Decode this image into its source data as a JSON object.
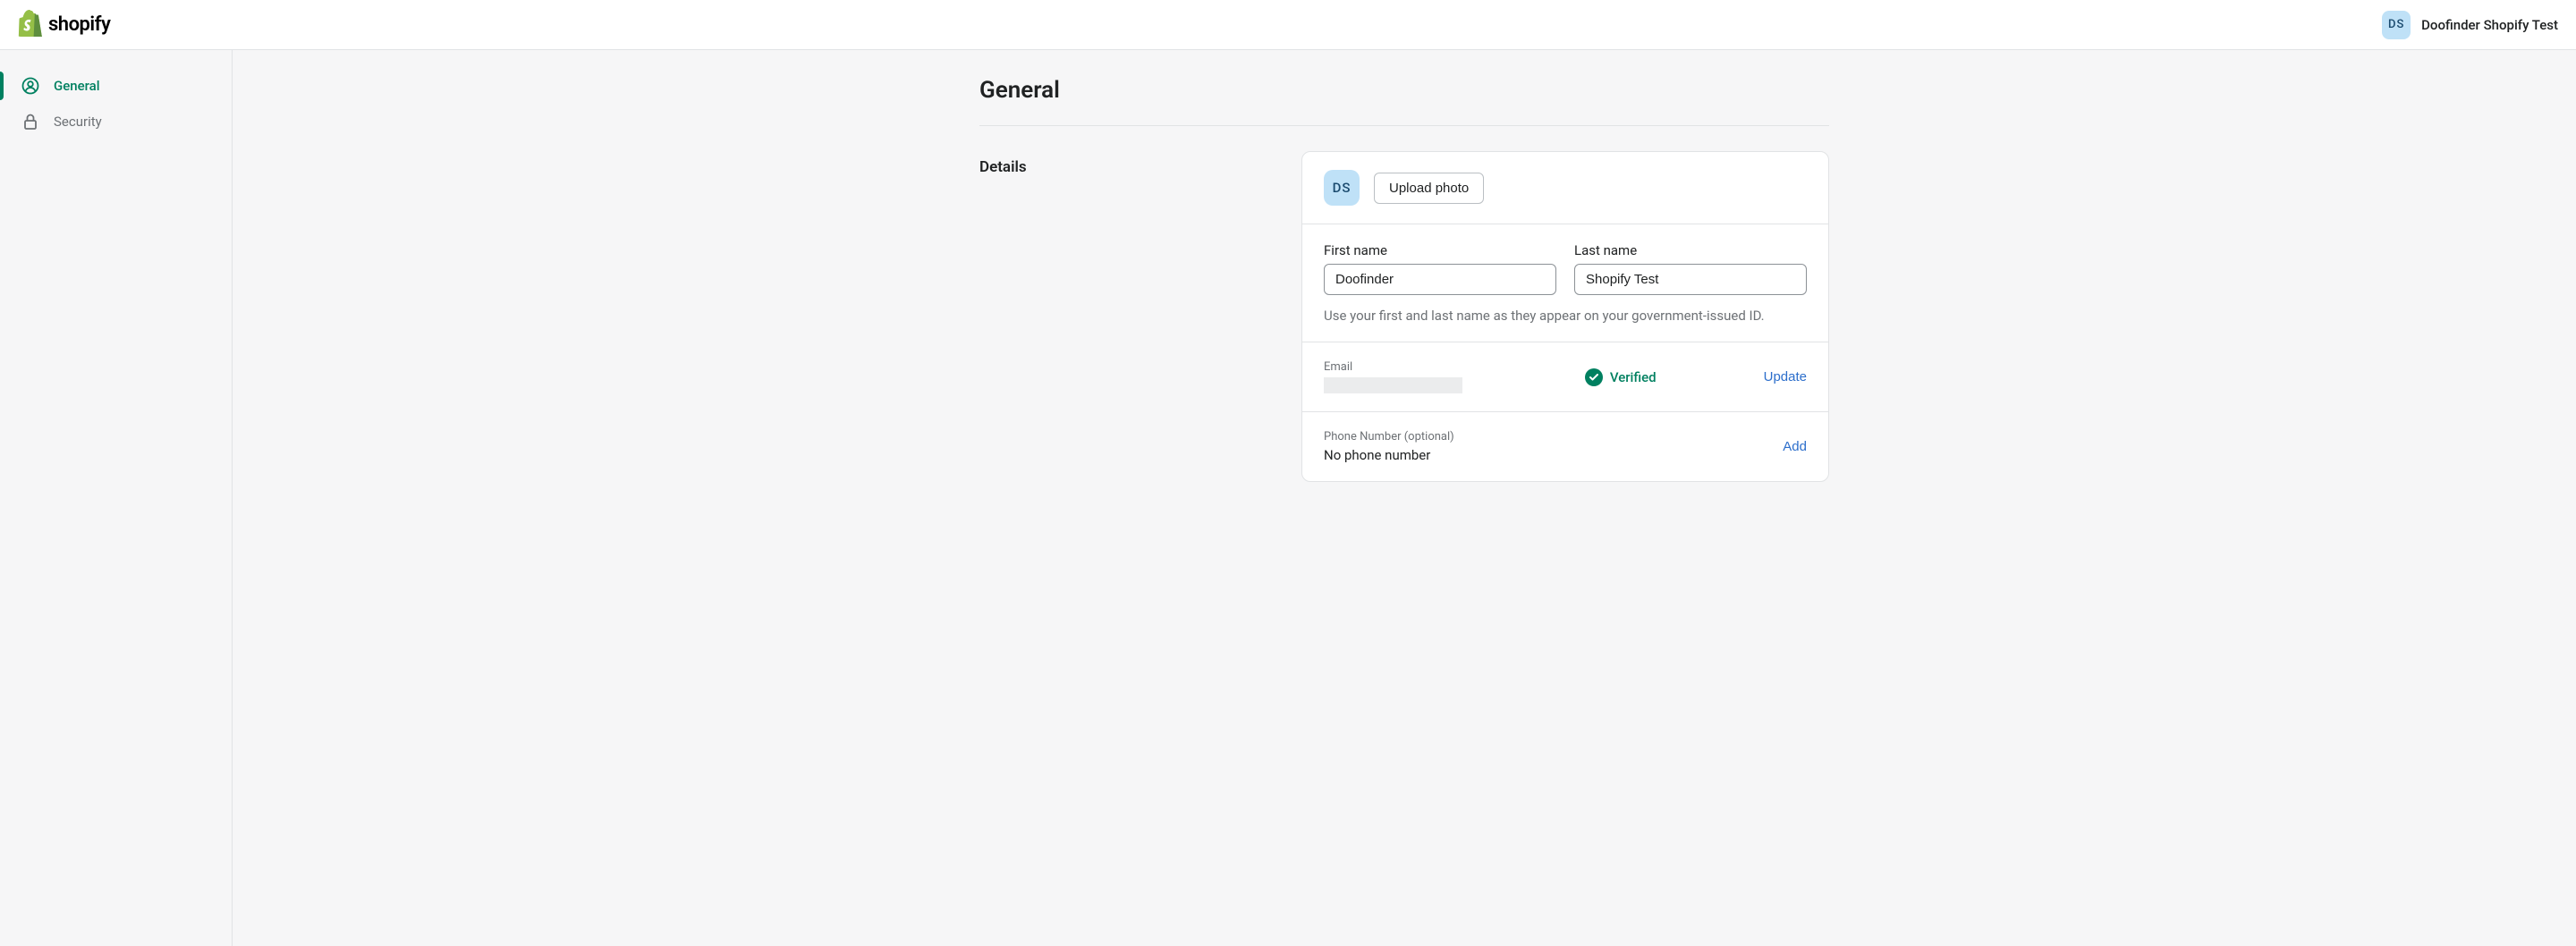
{
  "header": {
    "logo_text": "shopify",
    "avatar_initials": "DS",
    "store_name": "Doofinder Shopify Test"
  },
  "sidebar": {
    "items": [
      {
        "label": "General",
        "icon": "user-circle-icon",
        "active": true
      },
      {
        "label": "Security",
        "icon": "lock-icon",
        "active": false
      }
    ]
  },
  "page": {
    "title": "General",
    "section_label": "Details"
  },
  "details": {
    "avatar_initials": "DS",
    "upload_photo_label": "Upload photo",
    "first_name_label": "First name",
    "first_name_value": "Doofinder",
    "last_name_label": "Last name",
    "last_name_value": "Shopify Test",
    "name_help_text": "Use your first and last name as they appear on your government-issued ID.",
    "email_label": "Email",
    "verified_label": "Verified",
    "update_label": "Update",
    "phone_label": "Phone Number (optional)",
    "phone_value": "No phone number",
    "add_label": "Add"
  }
}
